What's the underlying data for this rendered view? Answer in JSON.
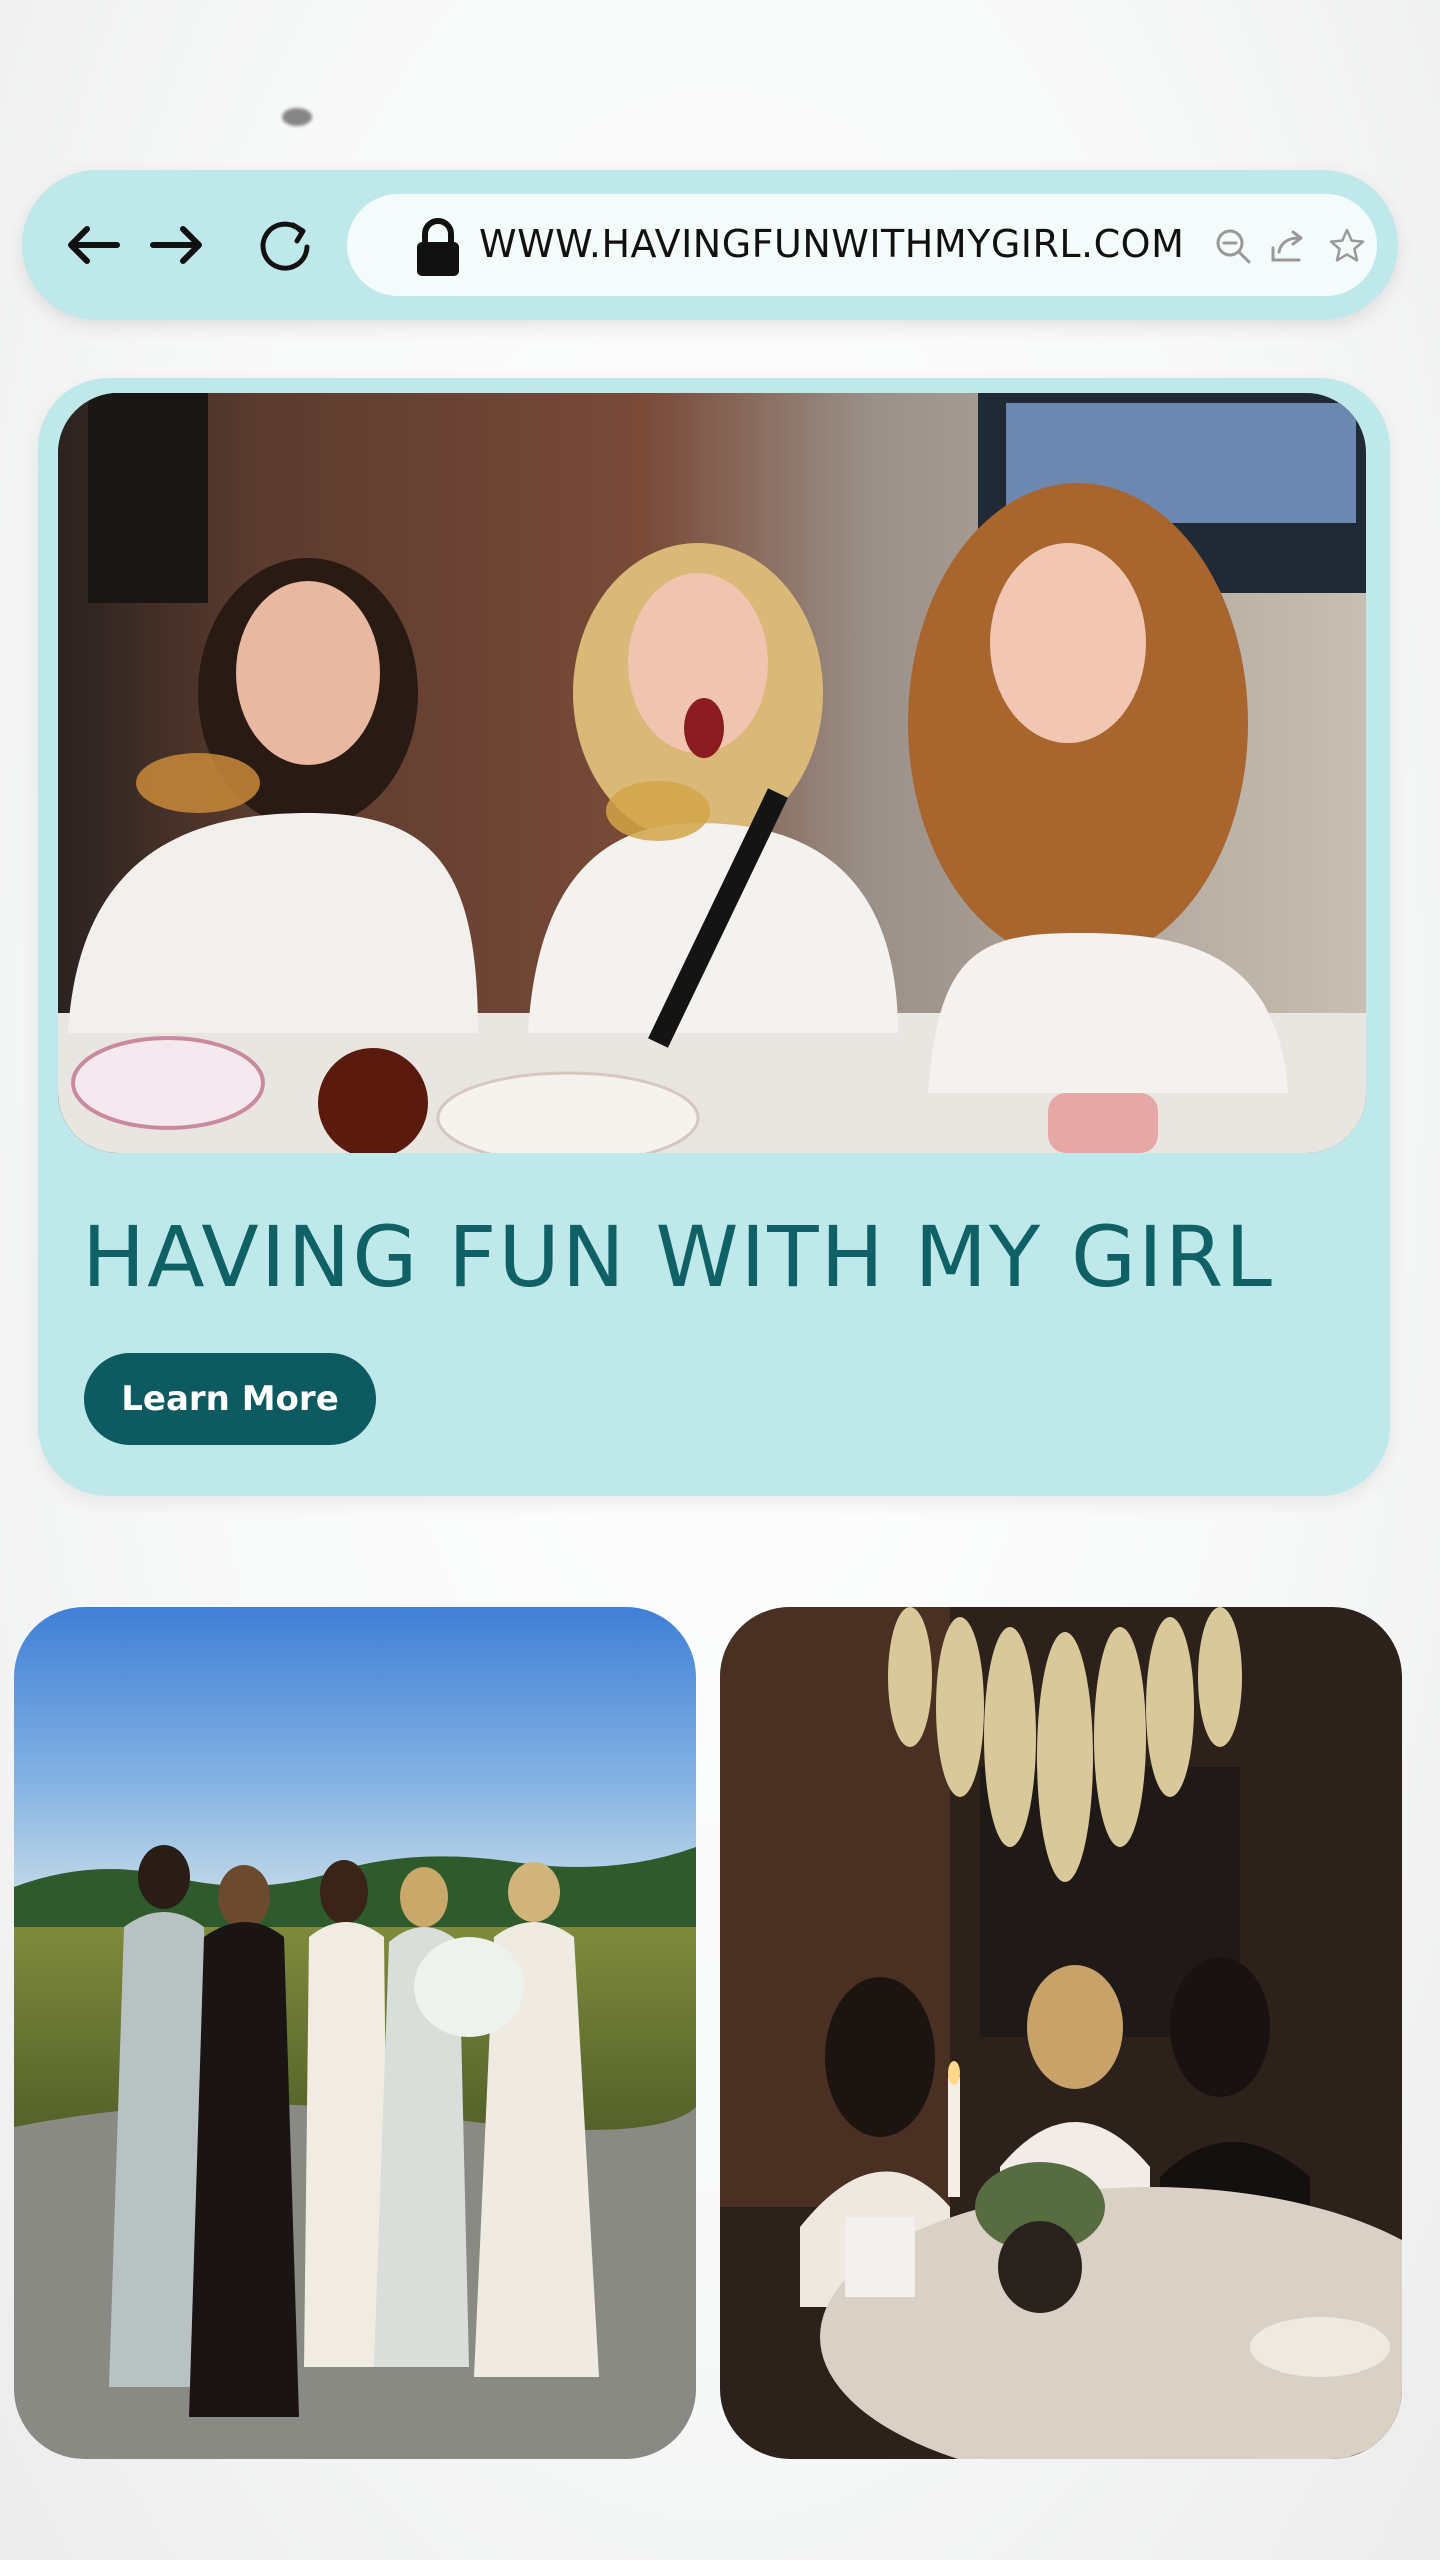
{
  "browser": {
    "url": "WWW.HAVINGFUNWITHMYGIRL.COM",
    "icons": [
      "back-arrow-icon",
      "forward-arrow-icon",
      "reload-icon",
      "lock-icon",
      "zoom-out-icon",
      "share-icon",
      "bookmark-star-icon"
    ]
  },
  "hero": {
    "title": "HAVING FUN WITH MY GIRL",
    "button_label": "Learn More",
    "photo": "three-women-dinner-toast-photo"
  },
  "gallery": {
    "left_photo": "five-women-field-photo",
    "right_photo": "women-dining-under-chandelier-photo"
  },
  "colors": {
    "accent": "#bfe8ea",
    "brand_dark": "#0d5a60",
    "title": "#0f6166"
  }
}
